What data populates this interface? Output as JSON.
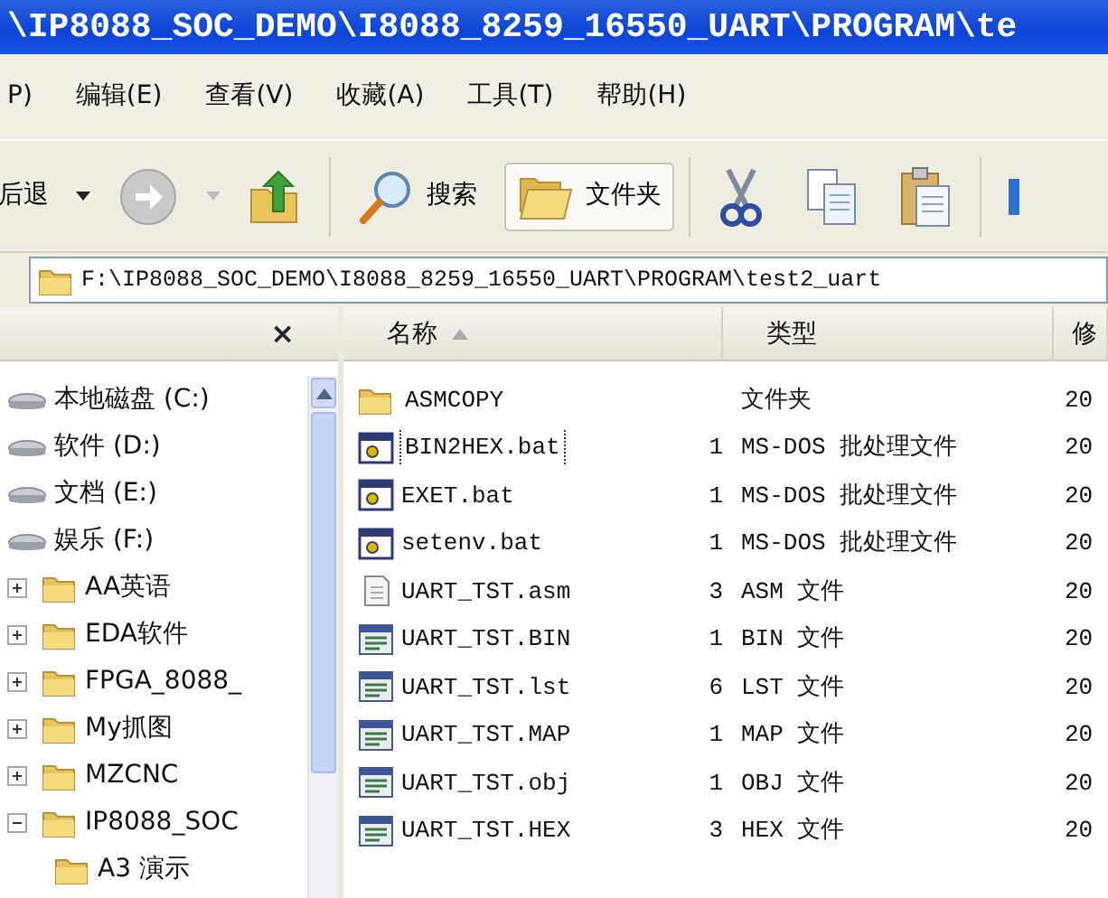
{
  "window": {
    "title": "\\IP8088_SOC_DEMO\\I8088_8259_16550_UART\\PROGRAM\\te"
  },
  "menu": [
    {
      "label": "P)"
    },
    {
      "label": "编辑(E)"
    },
    {
      "label": "查看(V)"
    },
    {
      "label": "收藏(A)"
    },
    {
      "label": "工具(T)"
    },
    {
      "label": "帮助(H)"
    }
  ],
  "toolbar": [
    {
      "kind": "back",
      "label": "后退",
      "selected": false
    },
    {
      "kind": "forward",
      "selected": false
    },
    {
      "kind": "up",
      "selected": false
    },
    {
      "kind": "search",
      "label": "搜索",
      "selected": false
    },
    {
      "kind": "folders",
      "label": "文件夹",
      "selected": true
    },
    {
      "kind": "cut",
      "selected": false
    },
    {
      "kind": "copy",
      "selected": false
    },
    {
      "kind": "paste",
      "selected": false
    },
    {
      "kind": "more",
      "selected": false
    }
  ],
  "address": {
    "path": "F:\\IP8088_SOC_DEMO\\I8088_8259_16550_UART\\PROGRAM\\test2_uart"
  },
  "folders_pane": {
    "close": "×",
    "tree": [
      {
        "kind": "drive",
        "label": "本地磁盘 (C:)"
      },
      {
        "kind": "drive",
        "label": "软件 (D:)"
      },
      {
        "kind": "drive",
        "label": "文档 (E:)"
      },
      {
        "kind": "drive",
        "label": "娱乐 (F:)"
      },
      {
        "kind": "folder",
        "label": "AA英语",
        "expanded": false
      },
      {
        "kind": "folder",
        "label": "EDA软件",
        "expanded": false
      },
      {
        "kind": "folder",
        "label": "FPGA_8088_",
        "expanded": false
      },
      {
        "kind": "folder",
        "label": "My抓图",
        "expanded": false
      },
      {
        "kind": "folder",
        "label": "MZCNC",
        "expanded": false
      },
      {
        "kind": "folder",
        "label": "IP8088_SOC",
        "expanded": true,
        "children": [
          {
            "kind": "leaf",
            "label": "A3 演示"
          }
        ]
      }
    ]
  },
  "file_list": {
    "columns": [
      {
        "label": "名称",
        "sorted": true
      },
      {
        "label": "类型",
        "sorted": false
      },
      {
        "label": "修",
        "sorted": false
      }
    ],
    "rows": [
      {
        "kind": "folder",
        "name": "ASMCOPY",
        "type": "文件夹",
        "date": "20",
        "focused": false
      },
      {
        "kind": "batch",
        "name": "BIN2HEX.bat",
        "size": "1",
        "type": "MS-DOS 批处理文件",
        "date": "20",
        "focused": true
      },
      {
        "kind": "batch",
        "name": "EXET.bat",
        "size": "1",
        "type": "MS-DOS 批处理文件",
        "date": "20",
        "focused": false
      },
      {
        "kind": "batch",
        "name": "setenv.bat",
        "size": "1",
        "type": "MS-DOS 批处理文件",
        "date": "20",
        "focused": false
      },
      {
        "kind": "text",
        "name": "UART_TST.asm",
        "size": "3",
        "type": "ASM 文件",
        "date": "20",
        "focused": false
      },
      {
        "kind": "program",
        "name": "UART_TST.BIN",
        "size": "1",
        "type": "BIN 文件",
        "date": "20",
        "focused": false
      },
      {
        "kind": "program",
        "name": "UART_TST.lst",
        "size": "6",
        "type": "LST 文件",
        "date": "20",
        "focused": false
      },
      {
        "kind": "program",
        "name": "UART_TST.MAP",
        "size": "1",
        "type": "MAP 文件",
        "date": "20",
        "focused": false
      },
      {
        "kind": "program",
        "name": "UART_TST.obj",
        "size": "1",
        "type": "OBJ 文件",
        "date": "20",
        "focused": false
      },
      {
        "kind": "program",
        "name": "UART_TST.HEX",
        "size": "3",
        "type": "HEX 文件",
        "date": "20",
        "focused": false
      }
    ]
  }
}
